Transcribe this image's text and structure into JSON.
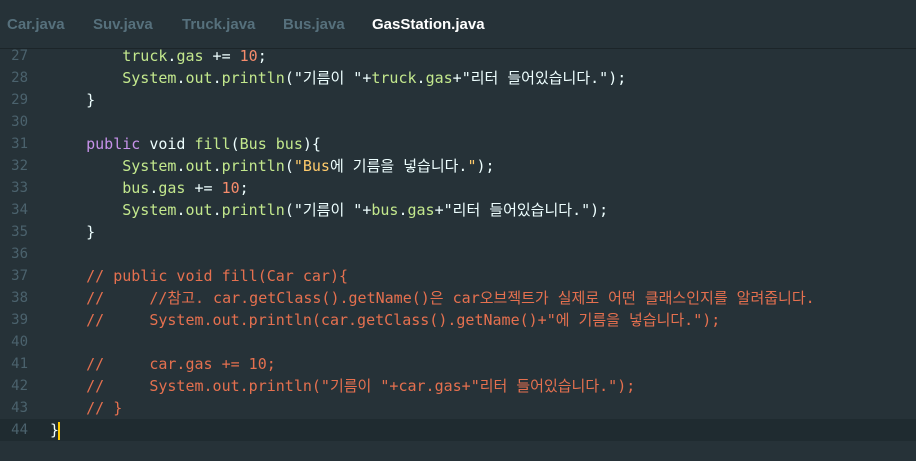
{
  "tabs": [
    {
      "label": "Car.java",
      "active": false
    },
    {
      "label": "Suv.java",
      "active": false
    },
    {
      "label": "Truck.java",
      "active": false
    },
    {
      "label": "Bus.java",
      "active": false
    },
    {
      "label": "GasStation.java",
      "active": true
    }
  ],
  "lines": [
    {
      "n": "27",
      "tokens": [
        [
          "        ",
          "id"
        ],
        [
          "truck",
          "sys"
        ],
        [
          ".",
          "id"
        ],
        [
          "gas",
          "sys"
        ],
        [
          " += ",
          "id"
        ],
        [
          "10",
          "num"
        ],
        [
          ";",
          "id"
        ]
      ]
    },
    {
      "n": "28",
      "tokens": [
        [
          "        ",
          "id"
        ],
        [
          "System",
          "sys"
        ],
        [
          ".",
          "id"
        ],
        [
          "out",
          "sys"
        ],
        [
          ".",
          "id"
        ],
        [
          "println",
          "sys"
        ],
        [
          "(",
          "id"
        ],
        [
          "\"기름이 \"",
          "str2"
        ],
        [
          "+",
          "id"
        ],
        [
          "truck",
          "sys"
        ],
        [
          ".",
          "id"
        ],
        [
          "gas",
          "sys"
        ],
        [
          "+",
          "id"
        ],
        [
          "\"리터 들어있습니다.\"",
          "str2"
        ],
        [
          ");",
          "id"
        ]
      ]
    },
    {
      "n": "29",
      "tokens": [
        [
          "    }",
          "id"
        ]
      ]
    },
    {
      "n": "30",
      "tokens": []
    },
    {
      "n": "31",
      "tokens": [
        [
          "    ",
          "id"
        ],
        [
          "public",
          "kw"
        ],
        [
          " ",
          "id"
        ],
        [
          "void",
          "id"
        ],
        [
          " ",
          "id"
        ],
        [
          "fill",
          "sys"
        ],
        [
          "(",
          "id"
        ],
        [
          "Bus",
          "sys"
        ],
        [
          " ",
          "id"
        ],
        [
          "bus",
          "sys"
        ],
        [
          "){",
          "id"
        ]
      ]
    },
    {
      "n": "32",
      "tokens": [
        [
          "        ",
          "id"
        ],
        [
          "System",
          "sys"
        ],
        [
          ".",
          "id"
        ],
        [
          "out",
          "sys"
        ],
        [
          ".",
          "id"
        ],
        [
          "println",
          "sys"
        ],
        [
          "(",
          "id"
        ],
        [
          "\"",
          "cls"
        ],
        [
          "Bus",
          "cls"
        ],
        [
          "에 기름을 넣습니다.",
          "id"
        ],
        [
          "\"",
          "cls"
        ],
        [
          ");",
          "id"
        ]
      ]
    },
    {
      "n": "33",
      "tokens": [
        [
          "        ",
          "id"
        ],
        [
          "bus",
          "sys"
        ],
        [
          ".",
          "id"
        ],
        [
          "gas",
          "sys"
        ],
        [
          " += ",
          "id"
        ],
        [
          "10",
          "num"
        ],
        [
          ";",
          "id"
        ]
      ]
    },
    {
      "n": "34",
      "tokens": [
        [
          "        ",
          "id"
        ],
        [
          "System",
          "sys"
        ],
        [
          ".",
          "id"
        ],
        [
          "out",
          "sys"
        ],
        [
          ".",
          "id"
        ],
        [
          "println",
          "sys"
        ],
        [
          "(",
          "id"
        ],
        [
          "\"기름이 \"",
          "str2"
        ],
        [
          "+",
          "id"
        ],
        [
          "bus",
          "sys"
        ],
        [
          ".",
          "id"
        ],
        [
          "gas",
          "sys"
        ],
        [
          "+",
          "id"
        ],
        [
          "\"리터 들어있습니다.\"",
          "str2"
        ],
        [
          ");",
          "id"
        ]
      ]
    },
    {
      "n": "35",
      "tokens": [
        [
          "    }",
          "id"
        ]
      ]
    },
    {
      "n": "36",
      "tokens": []
    },
    {
      "n": "37",
      "tokens": [
        [
          "    // public void fill(Car car){",
          "cmt"
        ]
      ]
    },
    {
      "n": "38",
      "tokens": [
        [
          "    //     //참고. car.getClass().getName()은 car오브젝트가 실제로 어떤 클래스인지를 알려줍니다.",
          "cmt"
        ]
      ]
    },
    {
      "n": "39",
      "tokens": [
        [
          "    //     System.out.println(car.getClass().getName()+\"에 기름을 넣습니다.\");",
          "cmt"
        ]
      ]
    },
    {
      "n": "40",
      "tokens": []
    },
    {
      "n": "41",
      "tokens": [
        [
          "    //     car.gas += 10;",
          "cmt"
        ]
      ]
    },
    {
      "n": "42",
      "tokens": [
        [
          "    //     System.out.println(\"기름이 \"+car.gas+\"리터 들어있습니다.\");",
          "cmt"
        ]
      ]
    },
    {
      "n": "43",
      "tokens": [
        [
          "    // }",
          "cmt"
        ]
      ]
    },
    {
      "n": "44",
      "tokens": [
        [
          "}",
          "id"
        ]
      ],
      "current": true
    }
  ],
  "colors": {
    "background": "#263238",
    "keyword": "#c792ea",
    "identifier": "#c3e88d",
    "string": "#eeffff",
    "number": "#f78c6c",
    "comment": "#e5704f",
    "cursor": "#ffcc00"
  }
}
